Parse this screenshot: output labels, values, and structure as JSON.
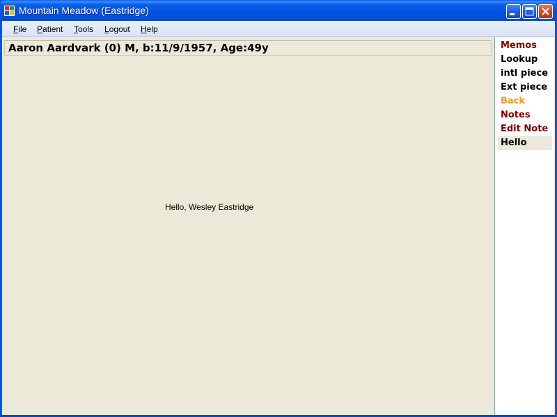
{
  "window": {
    "title": "Mountain Meadow (Eastridge)",
    "colors": {
      "titlebar": "#0a5fe8",
      "close": "#d8462a",
      "client": "#ece9d8"
    }
  },
  "menu": [
    {
      "accel": "F",
      "rest": "ile"
    },
    {
      "accel": "P",
      "rest": "atient"
    },
    {
      "accel": "T",
      "rest": "ools"
    },
    {
      "accel": "L",
      "rest": "ogout"
    },
    {
      "accel": "H",
      "rest": "elp"
    }
  ],
  "patient": {
    "header": "Aaron Aardvark (0) M, b:11/9/1957, Age:49y"
  },
  "main": {
    "greeting": "Hello, Wesley Eastridge"
  },
  "sidebar": {
    "items": [
      {
        "label": "Memos",
        "color": "#800000"
      },
      {
        "label": "Lookup",
        "color": "#000000"
      },
      {
        "label": "intl piece",
        "color": "#000000"
      },
      {
        "label": "Ext piece",
        "color": "#000000"
      },
      {
        "label": "Back",
        "color": "#e8a020"
      },
      {
        "label": "Notes",
        "color": "#800000"
      },
      {
        "label": "Edit Note",
        "color": "#800000"
      },
      {
        "label": "Hello",
        "color": "#000000",
        "selected": true
      }
    ]
  }
}
